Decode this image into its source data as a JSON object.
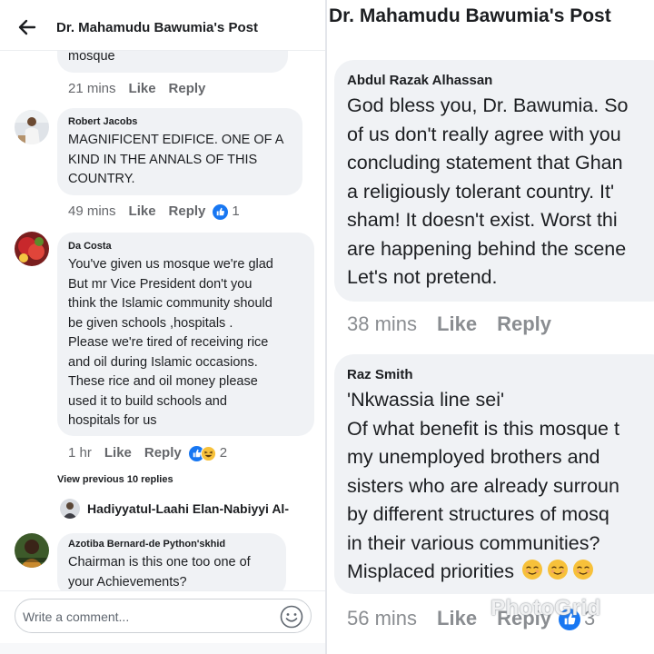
{
  "left": {
    "header": {
      "title": "Dr. Mahamudu Bawumia's Post"
    },
    "comments": [
      {
        "text_lines": [
          "mosque"
        ],
        "time": "21 mins",
        "like": "Like",
        "reply": "Reply"
      },
      {
        "name": "Robert Jacobs",
        "text_lines": [
          "MAGNIFICENT EDIFICE. ONE OF A",
          "KIND IN THE ANNALS OF THIS",
          "COUNTRY."
        ],
        "time": "49 mins",
        "like": "Like",
        "reply": "Reply",
        "reaction_count": "1"
      },
      {
        "name": "Da Costa",
        "text_lines": [
          "You've given us mosque we're glad",
          "But mr Vice President don't you",
          "think the Islamic community should",
          "be given schools ,hospitals .",
          "Please we're tired of receiving rice",
          "and oil during Islamic occasions.",
          "These rice and oil money please",
          "used it to build schools and",
          "hospitals for us"
        ],
        "time": "1 hr",
        "like": "Like",
        "reply": "Reply",
        "reaction_count": "2"
      },
      {
        "name": "Azotiba Bernard-de Python'skhid",
        "text_lines": [
          "Chairman is this one too one of",
          "your Achievements?"
        ]
      }
    ],
    "view_previous": "View previous 10 replies",
    "reply_preview_name": "Hadiyyatul-Laahi Elan-Nabiyyi Al-",
    "composer": {
      "placeholder": "Write a comment..."
    }
  },
  "right": {
    "header": {
      "title": "Dr. Mahamudu Bawumia's Post"
    },
    "comments": [
      {
        "name": "Abdul Razak Alhassan",
        "text_lines": [
          "God bless you, Dr. Bawumia. So",
          "of us don't really agree with you",
          "concluding statement that Ghan",
          "a religiously tolerant country. It'",
          "sham! It doesn't exist. Worst thi",
          "are happening behind the scene",
          "Let's not pretend."
        ],
        "time": "38 mins",
        "like": "Like",
        "reply": "Reply"
      },
      {
        "name": "Raz Smith",
        "text_lines": [
          "'Nkwassia line sei'",
          "Of what benefit is this mosque t",
          "my unemployed brothers and",
          "sisters who are already surroun",
          "by different structures of mosq",
          "in their various communities?",
          "Misplaced priorities"
        ],
        "time": "56 mins",
        "like": "Like",
        "reply": "Reply",
        "reaction_count": "3"
      }
    ],
    "watermark": "PhotoGrid"
  },
  "icons": {
    "back": "back-arrow-icon",
    "like_reaction": "thumbs-up-reaction-icon",
    "haha_reaction": "haha-reaction-icon",
    "emoji": "emoji-smiley-icon",
    "relieved": "relieved-face-icon"
  },
  "colors": {
    "bubble": "#f0f2f5",
    "meta_text": "#65676b",
    "like_blue": "#1877f2",
    "emoji_yellow": "#f7c13a"
  }
}
